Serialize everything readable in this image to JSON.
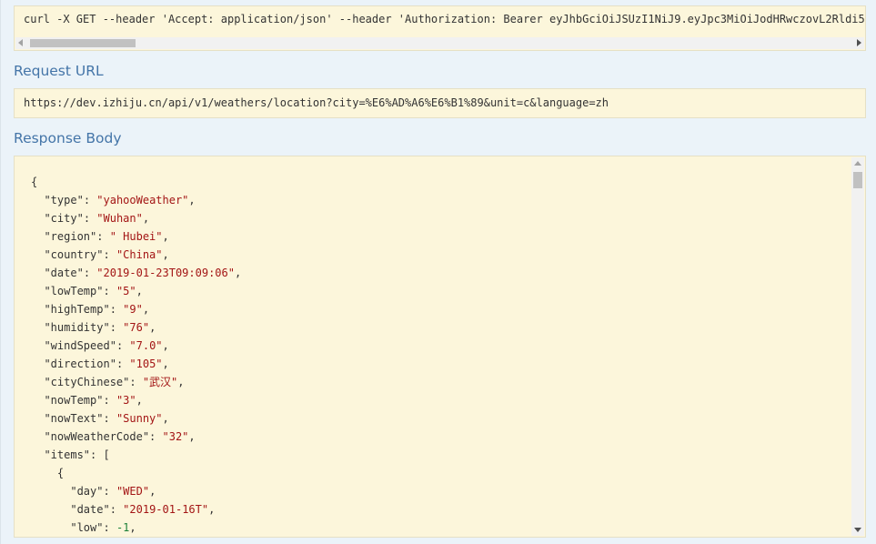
{
  "curl": {
    "command": "curl -X GET --header 'Accept: application/json' --header 'Authorization: Bearer eyJhbGciOiJSUzI1NiJ9.eyJpc3MiOiJodHRwczovL2Rldi5pe"
  },
  "request_url": {
    "title": "Request URL",
    "value": "https://dev.izhiju.cn/api/v1/weathers/location?city=%E6%AD%A6%E6%B1%89&unit=c&language=zh"
  },
  "response_body": {
    "title": "Response Body",
    "lines": [
      {
        "indent": 0,
        "text": "{"
      },
      {
        "indent": 1,
        "key": "\"type\"",
        "value": "\"yahooWeather\"",
        "kind": "str",
        "suffix": ","
      },
      {
        "indent": 1,
        "key": "\"city\"",
        "value": "\"Wuhan\"",
        "kind": "str",
        "suffix": ","
      },
      {
        "indent": 1,
        "key": "\"region\"",
        "value": "\" Hubei\"",
        "kind": "str",
        "suffix": ","
      },
      {
        "indent": 1,
        "key": "\"country\"",
        "value": "\"China\"",
        "kind": "str",
        "suffix": ","
      },
      {
        "indent": 1,
        "key": "\"date\"",
        "value": "\"2019-01-23T09:09:06\"",
        "kind": "str",
        "suffix": ","
      },
      {
        "indent": 1,
        "key": "\"lowTemp\"",
        "value": "\"5\"",
        "kind": "str",
        "suffix": ","
      },
      {
        "indent": 1,
        "key": "\"highTemp\"",
        "value": "\"9\"",
        "kind": "str",
        "suffix": ","
      },
      {
        "indent": 1,
        "key": "\"humidity\"",
        "value": "\"76\"",
        "kind": "str",
        "suffix": ","
      },
      {
        "indent": 1,
        "key": "\"windSpeed\"",
        "value": "\"7.0\"",
        "kind": "str",
        "suffix": ","
      },
      {
        "indent": 1,
        "key": "\"direction\"",
        "value": "\"105\"",
        "kind": "str",
        "suffix": ","
      },
      {
        "indent": 1,
        "key": "\"cityChinese\"",
        "value": "\"武汉\"",
        "kind": "str",
        "suffix": ","
      },
      {
        "indent": 1,
        "key": "\"nowTemp\"",
        "value": "\"3\"",
        "kind": "str",
        "suffix": ","
      },
      {
        "indent": 1,
        "key": "\"nowText\"",
        "value": "\"Sunny\"",
        "kind": "str",
        "suffix": ","
      },
      {
        "indent": 1,
        "key": "\"nowWeatherCode\"",
        "value": "\"32\"",
        "kind": "str",
        "suffix": ","
      },
      {
        "indent": 1,
        "key": "\"items\"",
        "text_after": "["
      },
      {
        "indent": 2,
        "text": "{"
      },
      {
        "indent": 3,
        "key": "\"day\"",
        "value": "\"WED\"",
        "kind": "str",
        "suffix": ","
      },
      {
        "indent": 3,
        "key": "\"date\"",
        "value": "\"2019-01-16T\"",
        "kind": "str",
        "suffix": ","
      },
      {
        "indent": 3,
        "key": "\"low\"",
        "value": "-1",
        "kind": "num",
        "suffix": ","
      }
    ]
  },
  "colors": {
    "background": "#ebf3f9",
    "panel": "#fcf6db",
    "section_title": "#4475a8",
    "json_string": "#a31515",
    "json_number": "#1a7f37"
  },
  "icons": {
    "scroll_left": "scroll-left-arrow-icon",
    "scroll_right": "scroll-right-arrow-icon",
    "scroll_up": "scroll-up-arrow-icon",
    "scroll_down": "scroll-down-arrow-icon"
  }
}
